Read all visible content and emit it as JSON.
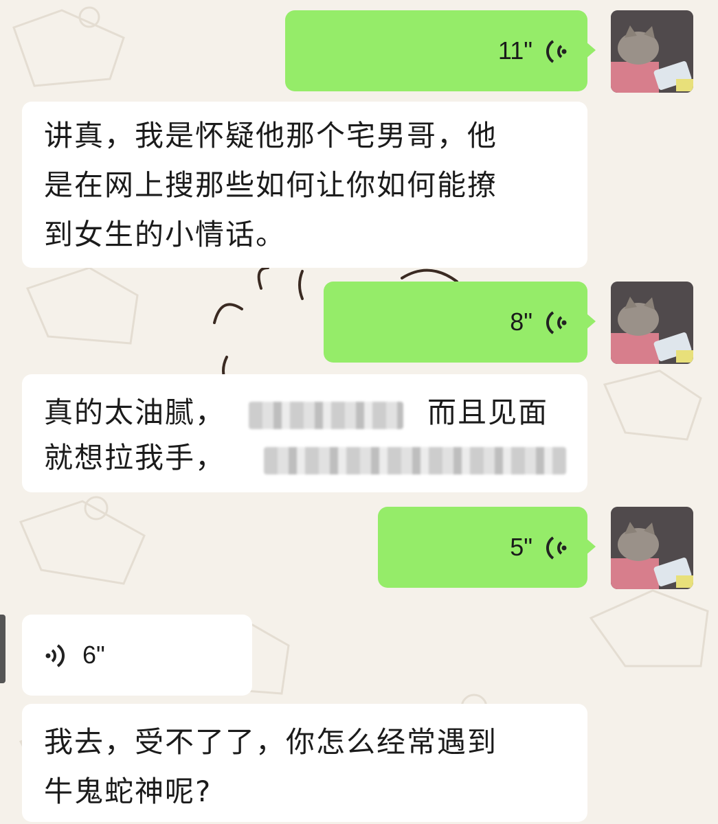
{
  "messages": [
    {
      "side": "sent",
      "type": "voice",
      "duration": "11\""
    },
    {
      "side": "received",
      "type": "text",
      "lines": [
        "讲真，我是怀疑他那个宅男哥，他",
        "是在网上搜那些如何让你如何能撩",
        "到女生的小情话。"
      ]
    },
    {
      "side": "sent",
      "type": "voice",
      "duration": "8\""
    },
    {
      "side": "received",
      "type": "text",
      "line1_start": "真的太油腻，",
      "line1_end": "而且见面",
      "line2_start": "就想拉我手，"
    },
    {
      "side": "sent",
      "type": "voice",
      "duration": "5\""
    },
    {
      "side": "received",
      "type": "voice",
      "duration": "6\""
    },
    {
      "side": "received",
      "type": "text",
      "lines": [
        "我去，受不了了，你怎么经常遇到",
        "牛鬼蛇神呢?"
      ]
    }
  ],
  "icons": {
    "voice": "voice-wave-icon",
    "avatar": "cat-avatar"
  },
  "colors": {
    "sent_bubble": "#95ec69",
    "received_bubble": "#ffffff",
    "background": "#f5f1ea"
  }
}
